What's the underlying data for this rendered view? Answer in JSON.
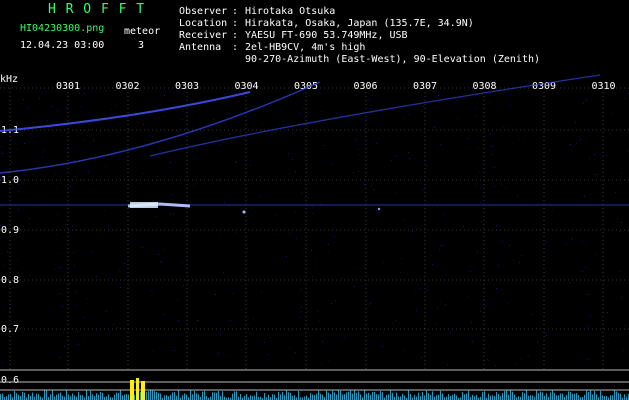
{
  "app_title": "H R O F F T",
  "file_name": "HI04230300.png",
  "datetime": "12.04.23 03:00",
  "meteor_label": "meteor",
  "meteor_count": "3",
  "station": {
    "observer_label": "Observer",
    "observer": "Hirotaka Otsuka",
    "location_label": "Location",
    "location": "Hirakata, Osaka, Japan (135.7E, 34.9N)",
    "receiver_label": "Receiver",
    "receiver": "YAESU FT-690 53.749MHz, USB",
    "antenna_label": "Antenna",
    "antenna": "2el-HB9CV, 4m's high",
    "antenna_detail": "90-270-Azimuth (East-West), 90-Elevation (Zenith)"
  },
  "unit_label": "kHz",
  "minute_labels": [
    "0301",
    "0302",
    "0303",
    "0304",
    "0305",
    "0306",
    "0307",
    "0308",
    "0309",
    "0310"
  ],
  "freq_labels": [
    "1.1",
    "1.0",
    "0.9",
    "0.8",
    "0.7",
    "0.6"
  ],
  "colors": {
    "background": "#000000",
    "title_green": "#33ff66",
    "trace_blue": "#3344ff",
    "level_cyan": "#33ccff",
    "meteor_yellow": "#ffee00"
  }
}
